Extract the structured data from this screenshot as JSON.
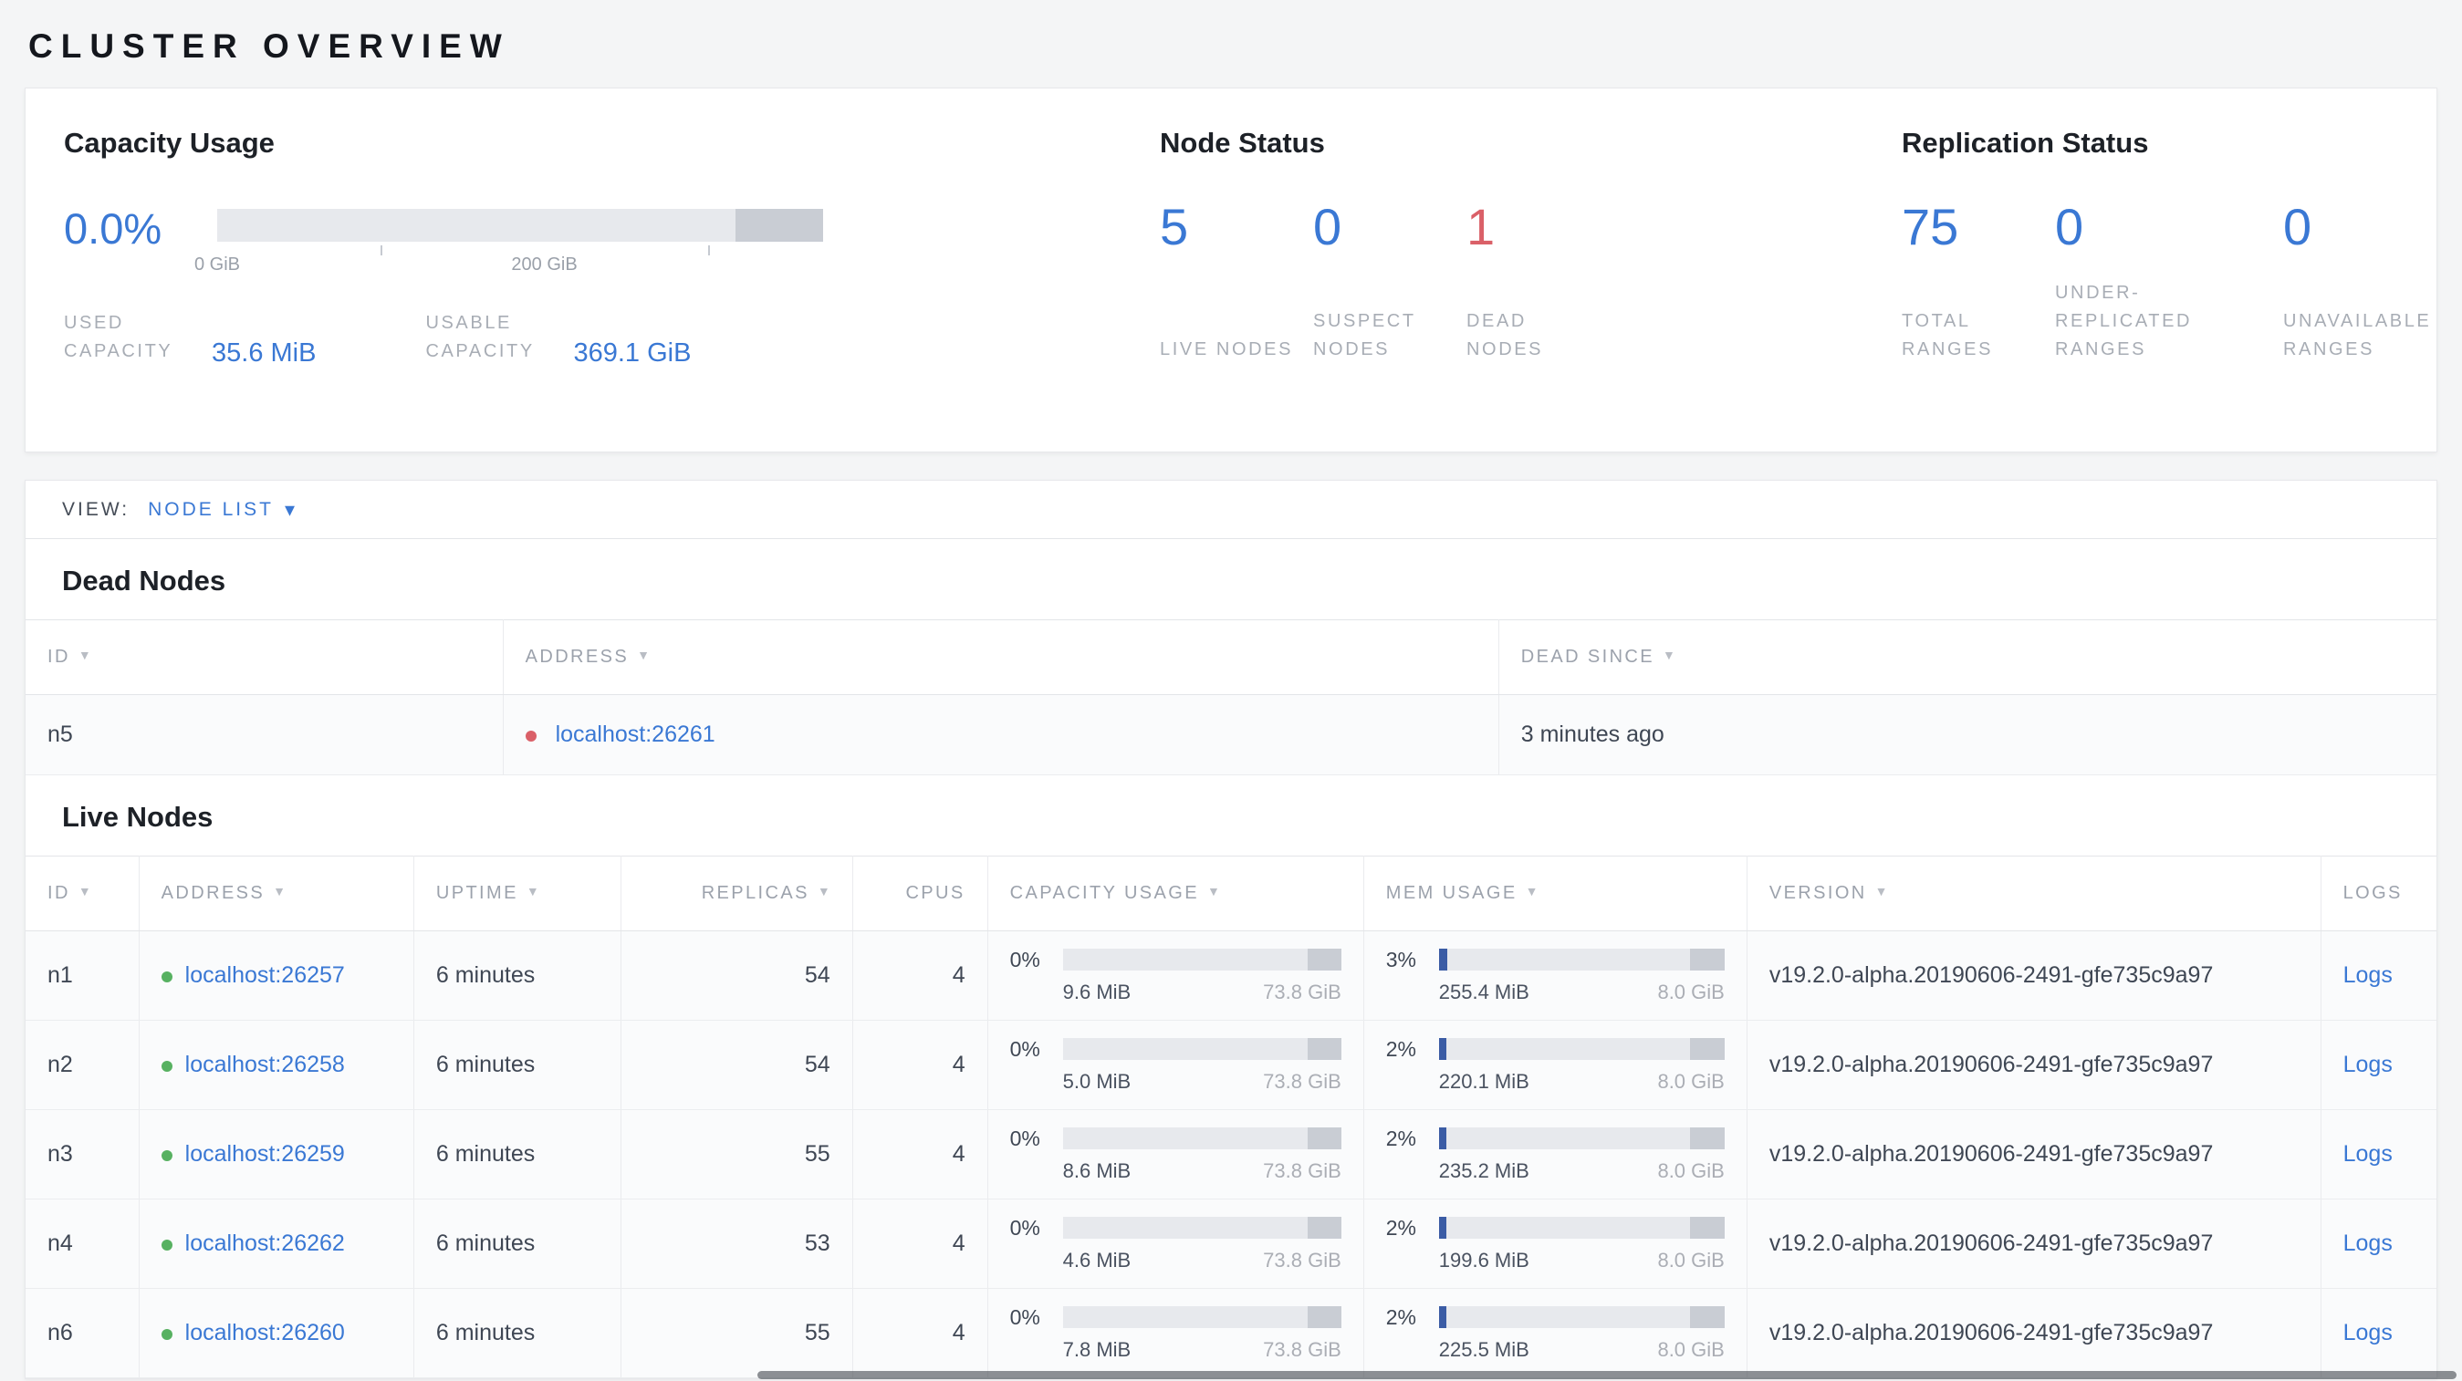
{
  "page": {
    "title": "CLUSTER OVERVIEW"
  },
  "icons": {
    "sort_desc": "▼",
    "caret_down": "▾"
  },
  "summary": {
    "capacity": {
      "title": "Capacity Usage",
      "percent": "0.0%",
      "percent_value": 0,
      "axis_labels": [
        {
          "text": "0 GiB"
        },
        {
          "text": "200 GiB"
        }
      ],
      "used": {
        "label": "USED CAPACITY",
        "value": "35.6 MiB"
      },
      "usable": {
        "label": "USABLE CAPACITY",
        "value": "369.1 GiB"
      }
    },
    "node_status": {
      "title": "Node Status",
      "stats": [
        {
          "value": "5",
          "label": "LIVE NODES",
          "status": "normal"
        },
        {
          "value": "0",
          "label": "SUSPECT NODES",
          "status": "normal"
        },
        {
          "value": "1",
          "label": "DEAD NODES",
          "status": "dead"
        }
      ]
    },
    "replication": {
      "title": "Replication Status",
      "stats": [
        {
          "value": "75",
          "label": "TOTAL RANGES"
        },
        {
          "value": "0",
          "label": "UNDER-REPLICATED RANGES"
        },
        {
          "value": "0",
          "label": "UNAVAILABLE RANGES"
        }
      ]
    }
  },
  "view_bar": {
    "label": "VIEW:",
    "selected": "NODE LIST"
  },
  "dead_nodes": {
    "title": "Dead Nodes",
    "columns": [
      "ID",
      "ADDRESS",
      "DEAD SINCE"
    ],
    "rows": [
      {
        "id": "n5",
        "address": "localhost:26261",
        "dead_since": "3 minutes ago"
      }
    ]
  },
  "live_nodes": {
    "title": "Live Nodes",
    "columns": [
      "ID",
      "ADDRESS",
      "UPTIME",
      "REPLICAS",
      "CPUS",
      "CAPACITY USAGE",
      "MEM USAGE",
      "VERSION",
      "LOGS"
    ],
    "logs_label": "Logs",
    "rows": [
      {
        "id": "n1",
        "address": "localhost:26257",
        "uptime": "6 minutes",
        "replicas": "54",
        "cpus": "4",
        "capacity": {
          "pct": "0%",
          "pct_value": 0,
          "used": "9.6 MiB",
          "total": "73.8 GiB"
        },
        "memory": {
          "pct": "3%",
          "pct_value": 3,
          "used": "255.4 MiB",
          "total": "8.0 GiB"
        },
        "version": "v19.2.0-alpha.20190606-2491-gfe735c9a97"
      },
      {
        "id": "n2",
        "address": "localhost:26258",
        "uptime": "6 minutes",
        "replicas": "54",
        "cpus": "4",
        "capacity": {
          "pct": "0%",
          "pct_value": 0,
          "used": "5.0 MiB",
          "total": "73.8 GiB"
        },
        "memory": {
          "pct": "2%",
          "pct_value": 2,
          "used": "220.1 MiB",
          "total": "8.0 GiB"
        },
        "version": "v19.2.0-alpha.20190606-2491-gfe735c9a97"
      },
      {
        "id": "n3",
        "address": "localhost:26259",
        "uptime": "6 minutes",
        "replicas": "55",
        "cpus": "4",
        "capacity": {
          "pct": "0%",
          "pct_value": 0,
          "used": "8.6 MiB",
          "total": "73.8 GiB"
        },
        "memory": {
          "pct": "2%",
          "pct_value": 2,
          "used": "235.2 MiB",
          "total": "8.0 GiB"
        },
        "version": "v19.2.0-alpha.20190606-2491-gfe735c9a97"
      },
      {
        "id": "n4",
        "address": "localhost:26262",
        "uptime": "6 minutes",
        "replicas": "53",
        "cpus": "4",
        "capacity": {
          "pct": "0%",
          "pct_value": 0,
          "used": "4.6 MiB",
          "total": "73.8 GiB"
        },
        "memory": {
          "pct": "2%",
          "pct_value": 2,
          "used": "199.6 MiB",
          "total": "8.0 GiB"
        },
        "version": "v19.2.0-alpha.20190606-2491-gfe735c9a97"
      },
      {
        "id": "n6",
        "address": "localhost:26260",
        "uptime": "6 minutes",
        "replicas": "55",
        "cpus": "4",
        "capacity": {
          "pct": "0%",
          "pct_value": 0,
          "used": "7.8 MiB",
          "total": "73.8 GiB"
        },
        "memory": {
          "pct": "2%",
          "pct_value": 2,
          "used": "225.5 MiB",
          "total": "8.0 GiB"
        },
        "version": "v19.2.0-alpha.20190606-2491-gfe735c9a97"
      }
    ]
  }
}
